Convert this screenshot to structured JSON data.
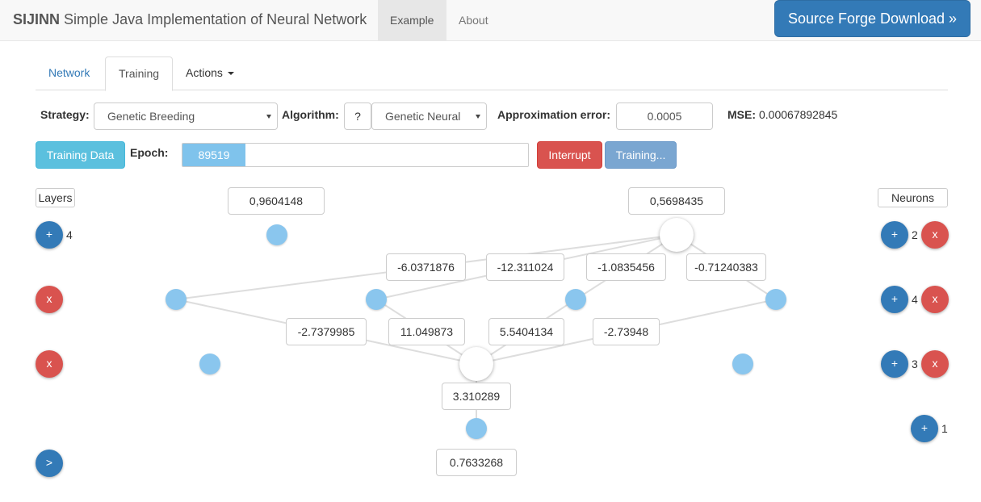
{
  "navbar": {
    "brand_bold": "SIJINN",
    "brand_rest": "Simple Java Implementation of Neural Network",
    "example": "Example",
    "about": "About",
    "download": "Source Forge Download »"
  },
  "tabs": {
    "network": "Network",
    "training": "Training",
    "actions": "Actions"
  },
  "controls": {
    "strategy_label": "Strategy:",
    "strategy_value": "Genetic Breeding",
    "algorithm_label": "Algorithm:",
    "algorithm_help": "?",
    "algorithm_value": "Genetic Neural",
    "approx_label": "Approximation error:",
    "approx_value": "0.0005",
    "mse_label": "MSE:",
    "mse_value": "0.00067892845",
    "training_data": "Training Data",
    "epoch_label": "Epoch:",
    "epoch_value": "89519",
    "interrupt": "Interrupt",
    "training": "Training..."
  },
  "side": {
    "layers": "Layers",
    "neurons": "Neurons",
    "layer_count": "4",
    "add": "+",
    "remove": "x",
    "run": ">",
    "neuron_counts": [
      "2",
      "4",
      "3",
      "1"
    ]
  },
  "network": {
    "top_values": [
      "0,9604148",
      "0,5698435"
    ],
    "weights_upper": [
      "-6.0371876",
      "-12.311024",
      "-1.0835456",
      "-0.71240383"
    ],
    "weights_lower": [
      "-2.7379985",
      "11.049873",
      "5.5404134",
      "-2.73948"
    ],
    "hidden_output": "3.310289",
    "final_output": "0.7633268"
  },
  "colors": {
    "primary": "#337ab7",
    "danger": "#d9534f",
    "info": "#5bc0de",
    "node": "#8ac6ee"
  }
}
